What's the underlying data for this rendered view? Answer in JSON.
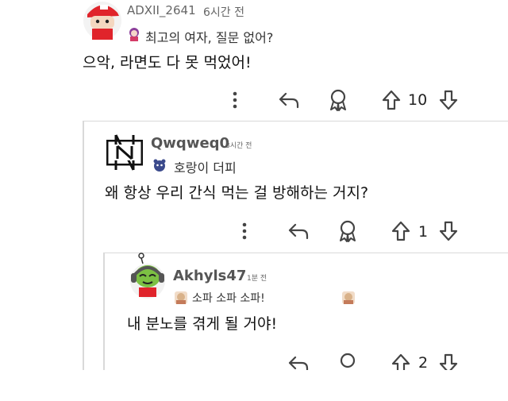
{
  "comments": [
    {
      "username": "ADXII_2641",
      "time": "6시간 전",
      "flair": "최고의 여자, 질문 없어?",
      "body": "으악, 라면도 다 못 먹었어!",
      "votes": "10",
      "icons": {
        "more": "more-vertical-icon",
        "reply": "reply-arrow-icon",
        "award": "award-icon",
        "upvote": "upvote-arrow-icon",
        "downvote": "downvote-arrow-icon"
      }
    },
    {
      "username": "Qwqweq0",
      "time": "3시간 전",
      "flair": "호랑이 더피",
      "body": "왜 항상 우리 간식 먹는 걸 방해하는 거지?",
      "votes": "1"
    },
    {
      "username": "Akhyls47",
      "time": "1분 전",
      "flair": "소파 소파 소파!",
      "body": "내 분노를 겪게 될 거야!",
      "votes": "2"
    }
  ],
  "colors": {
    "icon": "#444444",
    "thread": "#d9d9d9",
    "username": "#555555"
  }
}
